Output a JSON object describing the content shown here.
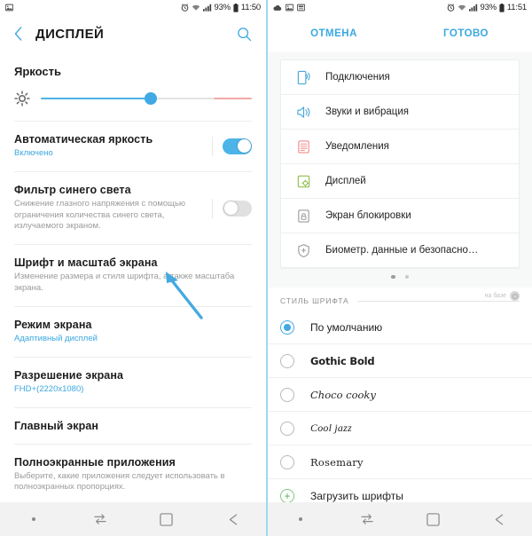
{
  "left": {
    "statusbar": {
      "left_icons": [
        "photo-icon"
      ],
      "right_icons": [
        "alarm-icon",
        "wifi-icon",
        "signal-icon"
      ],
      "battery_percent": "93%",
      "time": "11:50"
    },
    "appbar": {
      "back_icon": "back-chevron-icon",
      "title": "ДИСПЛЕЙ",
      "search_icon": "search-icon"
    },
    "brightness": {
      "label": "Яркость",
      "icon": "brightness-sun-icon",
      "value_percent": 52
    },
    "rows": [
      {
        "title": "Автоматическая яркость",
        "sub": "Включено",
        "sub_blue": true,
        "toggle": "on"
      },
      {
        "title": "Фильтр синего света",
        "sub": "Снижение глазного напряжения с помощью ограничения количества синего света, излучаемого экраном.",
        "sub_blue": false,
        "toggle": "off"
      },
      {
        "title": "Шрифт и масштаб экрана",
        "sub": "Изменение размера и стиля шрифта, а также масштаба экрана.",
        "sub_blue": false
      },
      {
        "title": "Режим экрана",
        "sub": "Адаптивный дисплей",
        "sub_blue": true
      },
      {
        "title": "Разрешение экрана",
        "sub": "FHD+(2220x1080)",
        "sub_blue": true
      },
      {
        "title": "Главный экран",
        "sub": ""
      },
      {
        "title": "Полноэкранные приложения",
        "sub": "Выберите, какие приложения следует использовать в полноэкранных пропорциях.",
        "sub_blue": false
      }
    ],
    "annotation": {
      "type": "pointer-arrow",
      "color": "#45a9e0"
    },
    "navbar": [
      "recents-dot-icon",
      "multitask-icon",
      "home-square-icon",
      "back-arrow-icon"
    ]
  },
  "right": {
    "statusbar": {
      "left_icons": [
        "cloud-icon",
        "image-icon",
        "screenshot-icon"
      ],
      "right_icons": [
        "alarm-icon",
        "wifi-icon",
        "signal-icon"
      ],
      "battery_percent": "93%",
      "time": "11:51"
    },
    "topbar": {
      "cancel_label": "ОТМЕНА",
      "done_label": "ГОТОВО"
    },
    "preview_menu": [
      {
        "label": "Подключения",
        "icon": "connections-icon",
        "color": "#4aa8d8"
      },
      {
        "label": "Звуки и вибрация",
        "icon": "sound-icon",
        "color": "#4aa8d8"
      },
      {
        "label": "Уведомления",
        "icon": "notifications-icon",
        "color": "#ef8f8f"
      },
      {
        "label": "Дисплей",
        "icon": "display-icon",
        "color": "#8fc04a"
      },
      {
        "label": "Экран блокировки",
        "icon": "lock-icon",
        "color": "#9c9c9c"
      },
      {
        "label": "Биометр. данные и безопасно…",
        "icon": "shield-icon",
        "color": "#9c9c9c"
      }
    ],
    "pager": {
      "count": 2,
      "active_index": 0
    },
    "font_section": {
      "header": "СТИЛЬ ШРИФТА",
      "brand_text": "на базе",
      "brand_icon": "brand-circle-icon"
    },
    "font_options": [
      {
        "label": "По умолчанию",
        "style": "f-default",
        "selected": true
      },
      {
        "label": "Gothic Bold",
        "style": "f-gothic",
        "selected": false
      },
      {
        "label": "Choco cooky",
        "style": "f-choco",
        "selected": false
      },
      {
        "label": "Cool jazz",
        "style": "f-cool",
        "selected": false
      },
      {
        "label": "Rosemary",
        "style": "f-rose",
        "selected": false
      }
    ],
    "download_fonts": {
      "label": "Загрузить шрифты",
      "icon": "plus-circle-icon"
    },
    "navbar": [
      "recents-dot-icon",
      "multitask-icon",
      "home-square-icon",
      "back-arrow-icon"
    ]
  },
  "colors": {
    "accent_blue": "#3ba8e0",
    "toggle_on": "#4cb4e7",
    "slider_fill": "#4db2e8",
    "slider_warm": "#f3aaa6",
    "green": "#52b552"
  }
}
